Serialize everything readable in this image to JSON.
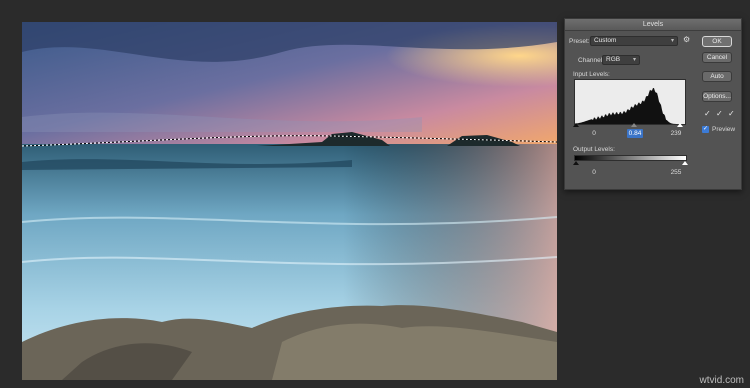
{
  "dialog": {
    "title": "Levels",
    "preset_label": "Preset:",
    "preset_value": "Custom",
    "channel_label": "Channel:",
    "channel_value": "RGB",
    "input_levels_label": "Input Levels:",
    "input_black": "0",
    "input_gamma": "0.84",
    "input_white": "239",
    "output_levels_label": "Output Levels:",
    "output_black": "0",
    "output_white": "255",
    "buttons": {
      "ok": "OK",
      "cancel": "Cancel",
      "auto": "Auto",
      "options": "Options..."
    },
    "preview_label": "Preview",
    "preview_checked": true,
    "selection_color": "#3b74c7"
  },
  "icons": {
    "preset_gear": "gear-icon",
    "eyedroppers": [
      "black-eyedropper-icon",
      "gray-eyedropper-icon",
      "white-eyedropper-icon"
    ]
  },
  "watermark": "wtvid.com"
}
